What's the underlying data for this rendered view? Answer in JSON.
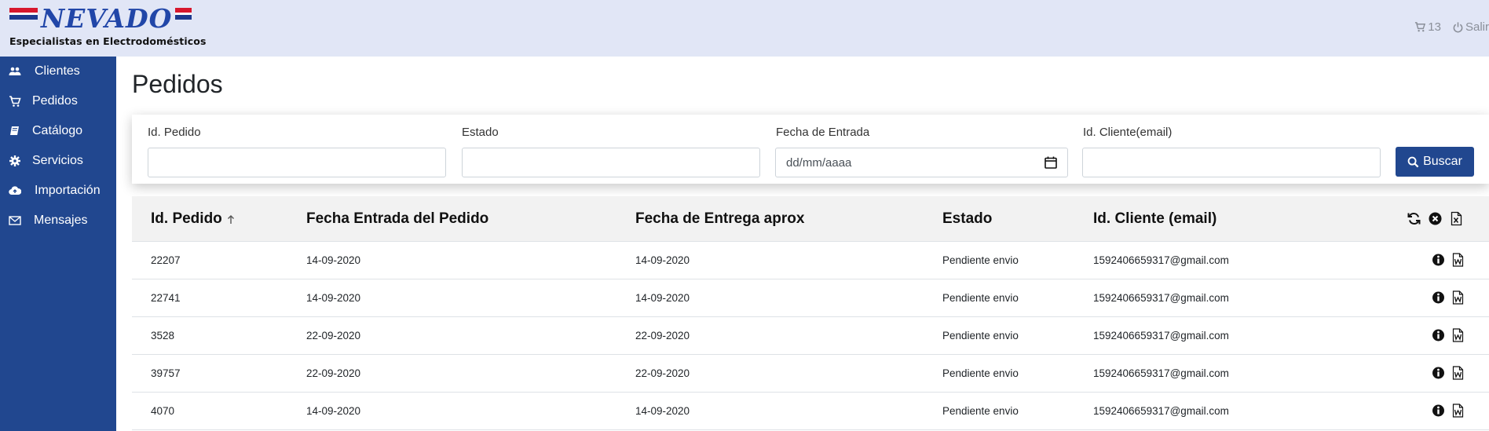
{
  "header": {
    "brand": "NEVADO",
    "tagline": "Especialistas en Electrodomésticos",
    "cart_count": "13",
    "logout_label": "Salir"
  },
  "sidebar": {
    "items": [
      {
        "label": "Clientes",
        "icon": "users-icon"
      },
      {
        "label": "Pedidos",
        "icon": "cart-icon"
      },
      {
        "label": "Catálogo",
        "icon": "book-icon"
      },
      {
        "label": "Servicios",
        "icon": "gear-icon"
      },
      {
        "label": "Importación",
        "icon": "cloud-upload-icon"
      },
      {
        "label": "Mensajes",
        "icon": "envelope-icon"
      }
    ]
  },
  "page": {
    "title": "Pedidos"
  },
  "filters": {
    "order_id_label": "Id. Pedido",
    "order_id_value": "",
    "status_label": "Estado",
    "status_value": "",
    "entry_date_label": "Fecha de Entrada",
    "entry_date_placeholder": "dd/mm/aaaa",
    "client_label": "Id. Cliente(email)",
    "client_value": "",
    "search_button": "Buscar"
  },
  "table": {
    "columns": [
      "Id. Pedido",
      "Fecha Entrada del Pedido",
      "Fecha de Entrega aprox",
      "Estado",
      "Id. Cliente (email)"
    ],
    "rows": [
      {
        "id": "22207",
        "entry": "14-09-2020",
        "delivery": "14-09-2020",
        "status": "Pendiente envio",
        "client": "1592406659317@gmail.com"
      },
      {
        "id": "22741",
        "entry": "14-09-2020",
        "delivery": "14-09-2020",
        "status": "Pendiente envio",
        "client": "1592406659317@gmail.com"
      },
      {
        "id": "3528",
        "entry": "22-09-2020",
        "delivery": "22-09-2020",
        "status": "Pendiente envio",
        "client": "1592406659317@gmail.com"
      },
      {
        "id": "39757",
        "entry": "22-09-2020",
        "delivery": "22-09-2020",
        "status": "Pendiente envio",
        "client": "1592406659317@gmail.com"
      },
      {
        "id": "4070",
        "entry": "14-09-2020",
        "delivery": "14-09-2020",
        "status": "Pendiente envio",
        "client": "1592406659317@gmail.com"
      }
    ]
  },
  "colors": {
    "sidebar": "#21478f",
    "header": "#e1e6f6",
    "button": "#21478f"
  }
}
